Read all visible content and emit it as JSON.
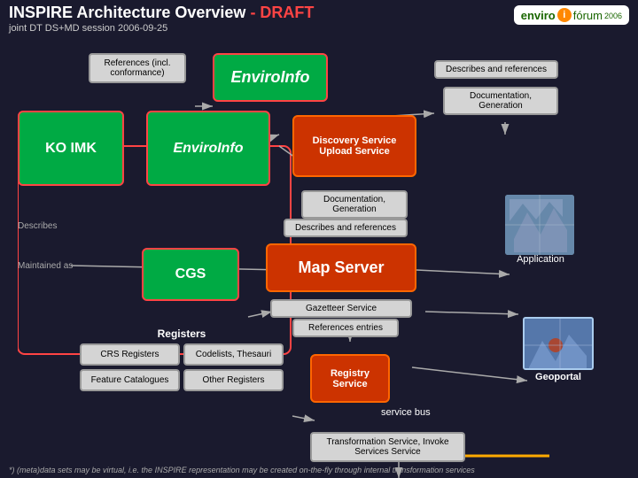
{
  "header": {
    "title": "INSPIRE Architecture Overview",
    "draft": " - DRAFT",
    "subtitle": "joint DT DS+MD session 2006-09-25"
  },
  "logo": {
    "prefix": "enviro",
    "i": "i",
    "suffix": "fórum",
    "year": "2006"
  },
  "diagram": {
    "ref_box": "References (incl. conformance)",
    "enviroinfo_top": "EnviroInfo",
    "describes_refs": "Describes and references",
    "doc_gen_top": "Documentation, Generation",
    "ko_imk": "KO IMK",
    "enviroinfo_mid": "EnviroInfo",
    "discovery_service": "Discovery Service",
    "upload_service": "Upload Service",
    "doc_gen_mid_line1": "Documentation,",
    "doc_gen_mid_line2": "Generation",
    "describes": "Describes",
    "describes_refs_bottom": "Describes and references",
    "application": "Application",
    "maintained_as": "Maintained as",
    "cgs": "CGS",
    "map_server": "Map Server",
    "gazetteer": "Gazetteer Service",
    "ref_entries": "References entries",
    "registers_title": "Registers",
    "crs_registers": "CRS Registers",
    "codelists_thesauri": "Codelists, Thesauri",
    "feature_catalogues": "Feature Catalogues",
    "other_registers": "Other Registers",
    "registry_service": "Registry Service",
    "service_bus": "service bus",
    "geoportal": "Geoportal",
    "transform_service": "Transformation Service, Invoke Services Service",
    "footer": "*) (meta)data sets may be virtual, i.e. the INSPIRE representation may be created on-the-fly through internal transformation services"
  }
}
